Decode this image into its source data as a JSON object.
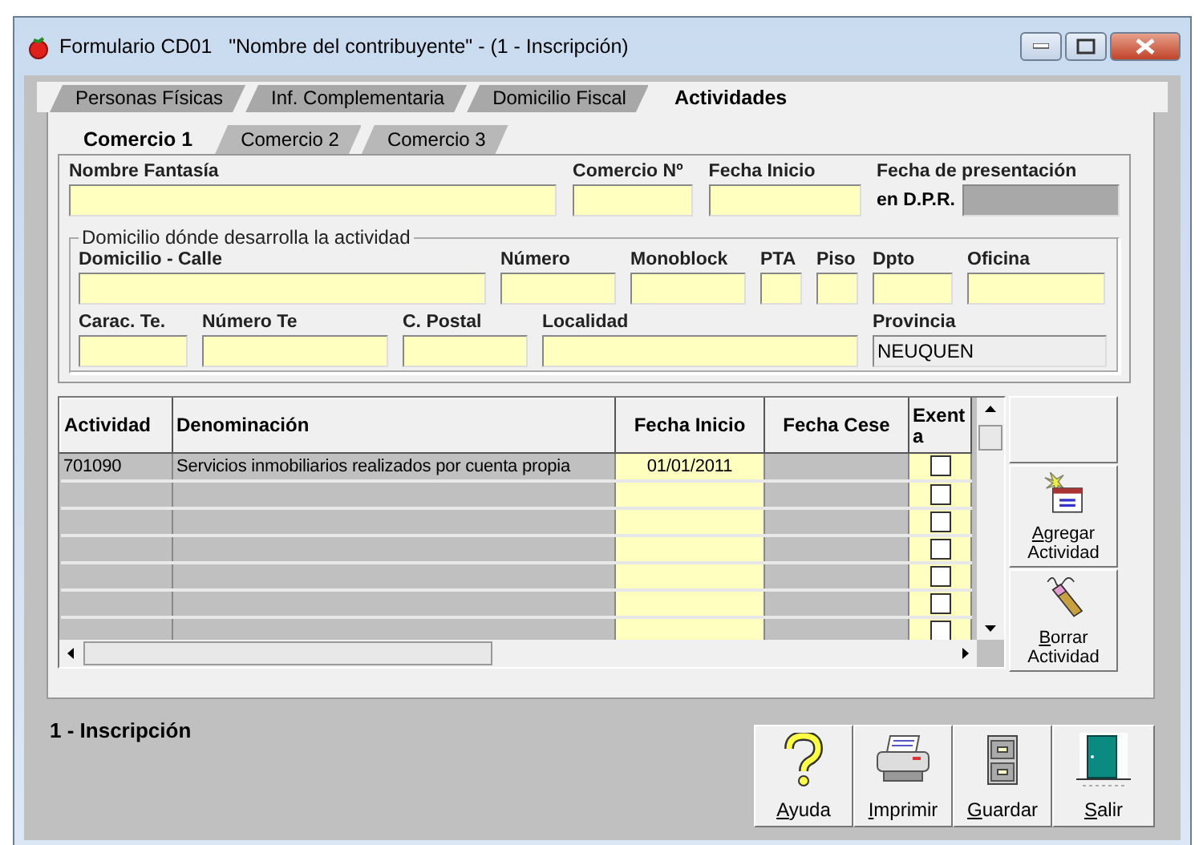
{
  "window": {
    "title": "Formulario CD01   \"Nombre del contribuyente\" - (1 - Inscripción)"
  },
  "tabs": [
    {
      "label": "Personas Físicas",
      "selected": false
    },
    {
      "label": "Inf. Complementaria",
      "selected": false
    },
    {
      "label": "Domicilio Fiscal",
      "selected": false
    },
    {
      "label": "Actividades",
      "selected": true
    }
  ],
  "subtabs": [
    {
      "label": "Comercio 1",
      "selected": true
    },
    {
      "label": "Comercio 2",
      "selected": false
    },
    {
      "label": "Comercio 3",
      "selected": false
    }
  ],
  "comercio_fields": [
    {
      "label": "Nombre Fantasía",
      "readonly": false
    },
    {
      "label": "Comercio Nº",
      "readonly": false
    },
    {
      "label": "Fecha Inicio",
      "readonly": false
    },
    {
      "label": "Fecha de presentación",
      "inline_label": "en D.P.R.",
      "readonly": true
    }
  ],
  "domicilio": {
    "title": "Domicilio dónde desarrolla la actividad",
    "row_1": [
      {
        "label": "Domicilio - Calle",
        "readonly": false
      },
      {
        "label": "Número",
        "readonly": false
      },
      {
        "label": "Monoblock",
        "readonly": false
      },
      {
        "label": "PTA",
        "readonly": false
      },
      {
        "label": "Piso",
        "readonly": false
      },
      {
        "label": "Dpto",
        "readonly": false
      },
      {
        "label": "Oficina",
        "readonly": false
      }
    ],
    "row_2": [
      {
        "label": "Carac. Te.",
        "readonly": false
      },
      {
        "label": "Número Te",
        "readonly": false
      },
      {
        "label": "C. Postal",
        "readonly": false
      },
      {
        "label": "Localidad",
        "readonly": false
      },
      {
        "label": "Provincia",
        "value": "NEUQUEN",
        "readonly": true
      }
    ]
  },
  "grid": {
    "columns": [
      "Actividad",
      "Denominación",
      "Fecha Inicio",
      "Fecha Cese",
      "Exent a"
    ],
    "rows": [
      {
        "actividad": "701090",
        "denominacion": "Servicios inmobiliarios realizados por cuenta propia",
        "fecha_inicio": "01/01/2011",
        "exenta": false
      },
      {
        "exenta": false
      },
      {
        "exenta": false
      },
      {
        "exenta": false
      },
      {
        "exenta": false
      },
      {
        "exenta": false
      },
      {
        "exenta": false
      }
    ]
  },
  "side_buttons": [
    {
      "label": "Agregar Actividad",
      "kind": "add"
    },
    {
      "label": "Borrar Actividad",
      "kind": "erase"
    }
  ],
  "status": "1 - Inscripción",
  "toolbar": [
    {
      "label": "Ayuda",
      "kind": "help"
    },
    {
      "label": "Imprimir",
      "kind": "print"
    },
    {
      "label": "Guardar",
      "kind": "save"
    },
    {
      "label": "Salir",
      "kind": "exit"
    }
  ]
}
